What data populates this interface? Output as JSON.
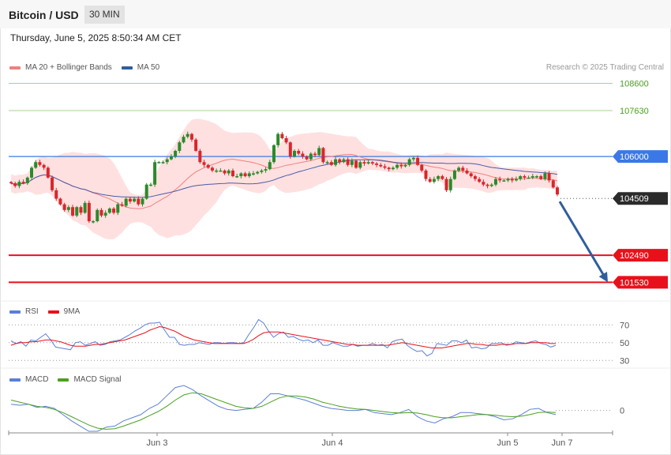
{
  "header": {
    "title": "Bitcoin / USD",
    "interval": "30 MIN",
    "datetime": "Thursday, June 5, 2025 8:50:34 AM CET"
  },
  "credit": "Research © 2025 Trading Central",
  "colors": {
    "bullish": "#2a8a2a",
    "bearish": "#d9262c",
    "ma20": "#f08080",
    "bands": "#ffd6d6",
    "ma50": "#4a5aa8",
    "resistance_green": "#8cc26a",
    "pivot_blue": "#3b78e7",
    "support_red": "#e8111b",
    "last_price_bg": "#2b2b2b",
    "arrow": "#2f5e9e",
    "rsi": "#5b7fd6",
    "rsi_ma": "#e8111b",
    "macd": "#5b7fd6",
    "macd_signal": "#4aa021"
  },
  "chart_data": [
    {
      "type": "candlestick",
      "title": "Bitcoin / USD",
      "legend": [
        {
          "name": "MA 20 + Bollinger Bands",
          "color": "#f08080"
        },
        {
          "name": "MA 50",
          "color": "#2f5e9e"
        }
      ],
      "ylim": [
        100950,
        108950
      ],
      "x_ticks": [
        "Jun 3",
        "Jun 4",
        "Jun 5",
        "Jun 7"
      ],
      "levels": [
        {
          "value": 108600,
          "label": "108600",
          "kind": "resistance"
        },
        {
          "value": 107630,
          "label": "107630",
          "kind": "resistance"
        },
        {
          "value": 106000,
          "label": "106000",
          "kind": "pivot"
        },
        {
          "value": 104509,
          "label": "104509",
          "kind": "last"
        },
        {
          "value": 102490,
          "label": "102490",
          "kind": "support"
        },
        {
          "value": 101530,
          "label": "101530",
          "kind": "support"
        }
      ],
      "forecast_arrow": {
        "from": 104400,
        "to": 101530
      },
      "close": [
        105050,
        104950,
        105100,
        105050,
        105250,
        105600,
        105800,
        105700,
        105600,
        105250,
        104800,
        104500,
        104300,
        104100,
        104200,
        103900,
        104200,
        104000,
        104350,
        103700,
        103700,
        104100,
        103900,
        104000,
        104150,
        104000,
        104300,
        104250,
        104500,
        104400,
        104500,
        104300,
        104500,
        105000,
        105000,
        105800,
        105800,
        105800,
        105900,
        106000,
        106200,
        106500,
        106700,
        106800,
        106600,
        106200,
        105800,
        105700,
        105600,
        105500,
        105500,
        105500,
        105400,
        105500,
        105300,
        105300,
        105400,
        105300,
        105400,
        105400,
        105450,
        105500,
        105550,
        105800,
        106400,
        106800,
        106650,
        106500,
        106000,
        106200,
        106100,
        106000,
        105900,
        106100,
        106050,
        106300,
        105800,
        105800,
        105700,
        105900,
        105800,
        105900,
        105700,
        105850,
        105600,
        105800,
        105750,
        105800,
        105750,
        105700,
        105650,
        105600,
        105550,
        105600,
        105700,
        105650,
        105700,
        105900,
        105950,
        105700,
        105500,
        105200,
        105100,
        105200,
        105300,
        105200,
        104800,
        105200,
        105500,
        105600,
        105500,
        105400,
        105300,
        105200,
        105100,
        105000,
        104950,
        105000,
        105200,
        105150,
        105150,
        105200,
        105150,
        105200,
        105300,
        105250,
        105250,
        105300,
        105300,
        105200,
        105400,
        105150,
        104900,
        104650
      ]
    },
    {
      "type": "line",
      "title": "RSI",
      "legend": [
        {
          "name": "RSI",
          "color": "#5b7fd6"
        },
        {
          "name": "9MA",
          "color": "#e8111b"
        }
      ],
      "y_ticks": [
        70,
        50,
        30
      ],
      "ylim": [
        24,
        80
      ],
      "series": [
        {
          "name": "RSI",
          "values": [
            52,
            49,
            51,
            46,
            53,
            52,
            56,
            60,
            53,
            45,
            44,
            43,
            42,
            50,
            51,
            47,
            49,
            51,
            47,
            48,
            51,
            52,
            53,
            56,
            59,
            63,
            66,
            70,
            72,
            72,
            73,
            64,
            56,
            56,
            48,
            47,
            48,
            48,
            50,
            49,
            48,
            50,
            50,
            49,
            50,
            50,
            49,
            50,
            59,
            67,
            76,
            72,
            63,
            56,
            60,
            62,
            56,
            57,
            54,
            52,
            53,
            50,
            53,
            47,
            47,
            50,
            48,
            46,
            46,
            48,
            46,
            47,
            47,
            49,
            47,
            48,
            44,
            51,
            53,
            54,
            47,
            43,
            40,
            41,
            35,
            38,
            49,
            48,
            47,
            52,
            52,
            50,
            53,
            44,
            45,
            43,
            44,
            49,
            49,
            50,
            47,
            48,
            51,
            50,
            49,
            51,
            52,
            49,
            48,
            45,
            47
          ]
        },
        {
          "name": "9MA",
          "values": [
            47,
            49,
            50,
            50,
            51,
            51,
            52,
            53,
            53,
            52,
            51,
            49,
            47,
            46,
            46,
            46,
            47,
            48,
            48,
            49,
            50,
            51,
            52,
            53,
            55,
            57,
            59,
            61,
            64,
            66,
            68,
            67,
            65,
            63,
            60,
            57,
            55,
            53,
            52,
            51,
            50,
            49,
            49,
            49,
            49,
            49,
            49,
            49,
            51,
            54,
            58,
            61,
            62,
            62,
            62,
            61,
            60,
            59,
            58,
            57,
            56,
            55,
            54,
            53,
            52,
            51,
            50,
            49,
            48,
            48,
            47,
            47,
            47,
            47,
            47,
            47,
            47,
            48,
            49,
            50,
            49,
            48,
            47,
            46,
            45,
            44,
            44,
            44,
            45,
            46,
            47,
            48,
            49,
            49,
            48,
            48,
            47,
            47,
            47,
            48,
            48,
            48,
            49,
            49,
            49,
            50,
            50,
            50,
            50,
            49,
            49
          ]
        }
      ]
    },
    {
      "type": "line",
      "title": "MACD",
      "legend": [
        {
          "name": "MACD",
          "color": "#5b7fd6"
        },
        {
          "name": "MACD Signal",
          "color": "#4aa021"
        }
      ],
      "y_ticks": [
        0
      ],
      "series": [
        {
          "name": "MACD",
          "values": [
            60,
            50,
            60,
            30,
            40,
            20,
            -40,
            -100,
            -150,
            -200,
            -200,
            -160,
            -150,
            -100,
            -70,
            -40,
            20,
            60,
            140,
            220,
            240,
            200,
            140,
            90,
            40,
            10,
            0,
            10,
            20,
            80,
            160,
            160,
            140,
            120,
            100,
            70,
            40,
            20,
            10,
            0,
            0,
            10,
            -20,
            -30,
            -40,
            -20,
            10,
            -60,
            -100,
            -120,
            -80,
            -60,
            -20,
            -20,
            -30,
            -40,
            -60,
            -90,
            -80,
            -40,
            10,
            20,
            -20,
            -40
          ]
        },
        {
          "name": "MACD Signal",
          "values": [
            100,
            80,
            60,
            40,
            30,
            10,
            -20,
            -60,
            -100,
            -140,
            -170,
            -180,
            -175,
            -150,
            -120,
            -90,
            -50,
            -10,
            40,
            100,
            150,
            170,
            160,
            130,
            100,
            70,
            40,
            25,
            20,
            40,
            80,
            120,
            140,
            140,
            130,
            110,
            80,
            60,
            40,
            25,
            15,
            10,
            0,
            -10,
            -20,
            -25,
            -20,
            -25,
            -40,
            -60,
            -70,
            -70,
            -60,
            -50,
            -40,
            -40,
            -45,
            -55,
            -60,
            -55,
            -40,
            -20,
            -15,
            -20
          ]
        }
      ]
    }
  ]
}
